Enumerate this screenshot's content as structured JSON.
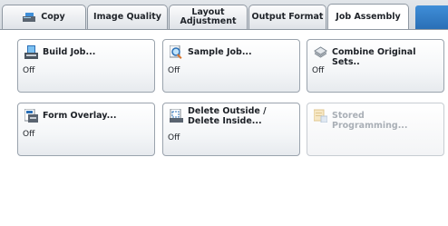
{
  "tabs": [
    {
      "label": "Copy",
      "active": false
    },
    {
      "label": "Image Quality",
      "active": false
    },
    {
      "label": "Layout\nAdjustment",
      "active": false
    },
    {
      "label": "Output Format",
      "active": false
    },
    {
      "label": "Job Assembly",
      "active": true
    }
  ],
  "buttons": {
    "build_job": {
      "label": "Build Job...",
      "value": "Off",
      "icon": "build-job-icon"
    },
    "sample_job": {
      "label": "Sample Job...",
      "value": "Off",
      "icon": "sample-job-icon"
    },
    "combine_sets": {
      "label": "Combine Original Sets..",
      "value": "Off",
      "icon": "combine-sets-icon"
    },
    "form_overlay": {
      "label": "Form Overlay...",
      "value": "Off",
      "icon": "form-overlay-icon"
    },
    "delete_outside": {
      "label": "Delete Outside /\nDelete Inside...",
      "value": "Off",
      "icon": "delete-outside-icon"
    },
    "stored_programming": {
      "label": "Stored Programming...",
      "value": "",
      "icon": "stored-programming-icon",
      "disabled": true
    }
  },
  "colors": {
    "accent_blue": "#2a6fb6",
    "disabled_text": "#a9afb6"
  }
}
